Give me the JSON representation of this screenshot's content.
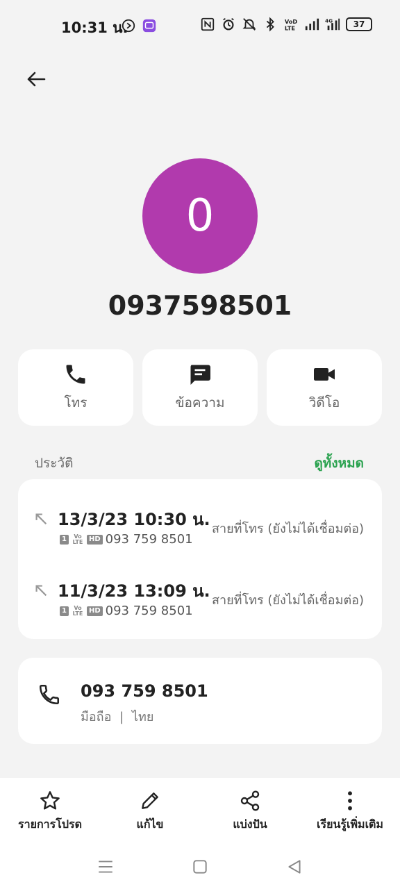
{
  "status_bar": {
    "time": "10:31 น.",
    "battery": "37",
    "icons_left": [
      "play-circle-icon",
      "app-icon"
    ],
    "icons_right": [
      "nfc-icon",
      "alarm-icon",
      "mute-icon",
      "bluetooth-icon",
      "volte-icon",
      "signal-icon",
      "4g-signal-icon",
      "battery-icon"
    ]
  },
  "contact": {
    "avatar_letter": "0",
    "avatar_color": "#b13aad",
    "number": "0937598501"
  },
  "actions": [
    {
      "label": "โทร",
      "icon": "phone-icon"
    },
    {
      "label": "ข้อความ",
      "icon": "message-icon"
    },
    {
      "label": "วิดีโอ",
      "icon": "video-icon"
    }
  ],
  "history": {
    "title": "ประวัติ",
    "view_all": "ดูทั้งหมด",
    "entries": [
      {
        "datetime": "13/3/23 10:30 น.",
        "sim": "1",
        "volte": "Vo LTE",
        "hd": "HD",
        "number": "093 759 8501",
        "status": "สายที่โทร (ยังไม่ได้เชื่อมต่อ)"
      },
      {
        "datetime": "11/3/23 13:09 น.",
        "sim": "1",
        "volte": "Vo LTE",
        "hd": "HD",
        "number": "093 759 8501",
        "status": "สายที่โทร (ยังไม่ได้เชื่อมต่อ)"
      }
    ]
  },
  "phone": {
    "number": "093 759 8501",
    "type": "มือถือ",
    "separator": "|",
    "country": "ไทย"
  },
  "bottom_bar": [
    {
      "label": "รายการโปรด",
      "icon": "star-icon"
    },
    {
      "label": "แก้ไข",
      "icon": "pencil-icon"
    },
    {
      "label": "แบ่งปัน",
      "icon": "share-icon"
    },
    {
      "label": "เรียนรู้เพิ่มเติม",
      "icon": "more-vertical-icon"
    }
  ],
  "colors": {
    "accent_green": "#2aa24f",
    "background": "#f3f3f3"
  }
}
